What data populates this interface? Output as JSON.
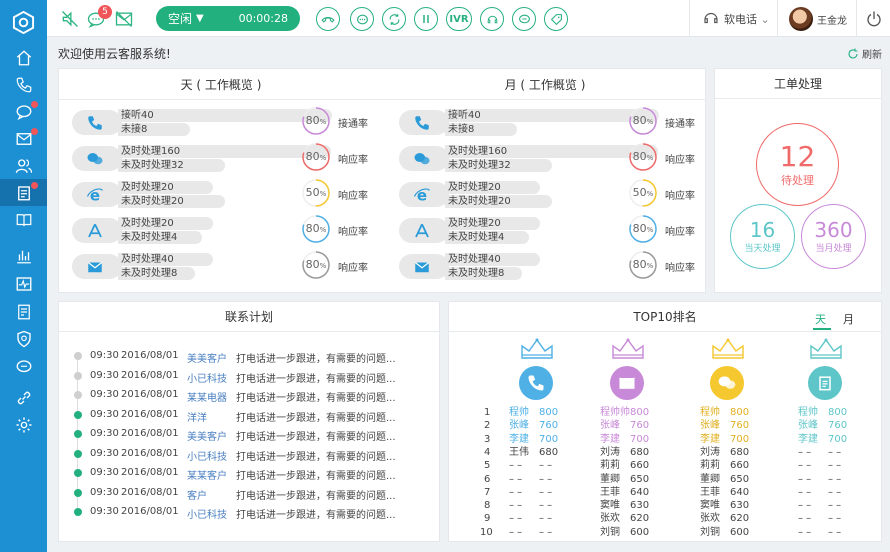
{
  "topbar": {
    "notif_count": "5",
    "status": "空闲",
    "timer": "00:00:28",
    "ivr_label": "IVR",
    "phone_mode": "软电话",
    "user_name": "王金龙"
  },
  "welcome": "欢迎使用云客服系统!",
  "refresh_label": "刷新",
  "overview_day": {
    "title": "天 ( 工作概览 )",
    "rows": [
      {
        "icon": "phone-icon",
        "line1": "接听40",
        "line2": "未接8",
        "rate": "80",
        "rate_label": "接通率",
        "color": "#c88ad8"
      },
      {
        "icon": "chat-icon",
        "line1": "及时处理160",
        "line2": "未及时处理32",
        "rate": "80",
        "rate_label": "响应率",
        "color": "#f06a6a"
      },
      {
        "icon": "ie-icon",
        "line1": "及时处理20",
        "line2": "未及时处理20",
        "rate": "50",
        "rate_label": "响应率",
        "color": "#f5c830"
      },
      {
        "icon": "appstore-icon",
        "line1": "及时处理20",
        "line2": "未及时处理4",
        "rate": "80",
        "rate_label": "响应率",
        "color": "#4fb0e6"
      },
      {
        "icon": "mail-icon",
        "line1": "及时处理40",
        "line2": "未及时处理8",
        "rate": "80",
        "rate_label": "响应率",
        "color": "#9a9a9a"
      }
    ]
  },
  "overview_month": {
    "title": "月 ( 工作概览 )",
    "rows": [
      {
        "icon": "phone-icon",
        "line1": "接听40",
        "line2": "未接8",
        "rate": "80",
        "rate_label": "接通率",
        "color": "#c88ad8"
      },
      {
        "icon": "chat-icon",
        "line1": "及时处理160",
        "line2": "未及时处理32",
        "rate": "80",
        "rate_label": "响应率",
        "color": "#f06a6a"
      },
      {
        "icon": "ie-icon",
        "line1": "及时处理20",
        "line2": "未及时处理20",
        "rate": "50",
        "rate_label": "响应率",
        "color": "#f5c830"
      },
      {
        "icon": "appstore-icon",
        "line1": "及时处理20",
        "line2": "未及时处理4",
        "rate": "80",
        "rate_label": "响应率",
        "color": "#4fb0e6"
      },
      {
        "icon": "mail-icon",
        "line1": "及时处理40",
        "line2": "未及时处理8",
        "rate": "80",
        "rate_label": "响应率",
        "color": "#9a9a9a"
      }
    ]
  },
  "workorder": {
    "title": "工单处理",
    "pending_value": "12",
    "pending_label": "待处理",
    "today_value": "16",
    "today_label": "当天处理",
    "month_value": "360",
    "month_label": "当月处理"
  },
  "contact_plan": {
    "title": "联系计划",
    "rows": [
      {
        "time": "09:30",
        "date": "2016/08/01",
        "customer": "美美客户",
        "note": "打电话进一步跟进，有需要的问题...",
        "done": false
      },
      {
        "time": "09:30",
        "date": "2016/08/01",
        "customer": "小已科技",
        "note": "打电话进一步跟进，有需要的问题...",
        "done": false
      },
      {
        "time": "09:30",
        "date": "2016/08/01",
        "customer": "某某电器",
        "note": "打电话进一步跟进，有需要的问题...",
        "done": false
      },
      {
        "time": "09:30",
        "date": "2016/08/01",
        "customer": "洋洋",
        "note": "打电话进一步跟进，有需要的问题...",
        "done": true
      },
      {
        "time": "09:30",
        "date": "2016/08/01",
        "customer": "美美客户",
        "note": "打电话进一步跟进，有需要的问题...",
        "done": true
      },
      {
        "time": "09:30",
        "date": "2016/08/01",
        "customer": "小已科技",
        "note": "打电话进一步跟进，有需要的问题...",
        "done": true
      },
      {
        "time": "09:30",
        "date": "2016/08/01",
        "customer": "某某客户",
        "note": "打电话进一步跟进，有需要的问题...",
        "done": true
      },
      {
        "time": "09:30",
        "date": "2016/08/01",
        "customer": "客户",
        "note": "打电话进一步跟进，有需要的问题...",
        "done": true
      },
      {
        "time": "09:30",
        "date": "2016/08/01",
        "customer": "小已科技",
        "note": "打电话进一步跟进，有需要的问题...",
        "done": true
      }
    ]
  },
  "top10": {
    "title": "TOP10排名",
    "tab_day": "天",
    "tab_month": "月",
    "categories": [
      {
        "icon": "phone-icon",
        "color": "#4fb0e6"
      },
      {
        "icon": "mail-icon",
        "color": "#c88ad8"
      },
      {
        "icon": "chat-icon",
        "color": "#f5c830"
      },
      {
        "icon": "clipboard-icon",
        "color": "#5ec6c8"
      }
    ],
    "ranks": [
      "1",
      "2",
      "3",
      "4",
      "5",
      "6",
      "7",
      "8",
      "9",
      "10"
    ],
    "columns": [
      [
        [
          "程帅",
          "800"
        ],
        [
          "张峰",
          "760"
        ],
        [
          "李建",
          "700"
        ],
        [
          "王伟",
          "680"
        ],
        [
          "– –",
          "– –"
        ],
        [
          "– –",
          "– –"
        ],
        [
          "– –",
          "– –"
        ],
        [
          "– –",
          "– –"
        ],
        [
          "– –",
          "– –"
        ],
        [
          "– –",
          "– –"
        ]
      ],
      [
        [
          "程帅帅",
          "800"
        ],
        [
          "张峰",
          "760"
        ],
        [
          "李建",
          "700"
        ],
        [
          "刘涛",
          "680"
        ],
        [
          "莉莉",
          "660"
        ],
        [
          "董卿",
          "650"
        ],
        [
          "王菲",
          "640"
        ],
        [
          "窦唯",
          "630"
        ],
        [
          "张欢",
          "620"
        ],
        [
          "刘铜",
          "600"
        ]
      ],
      [
        [
          "程帅",
          "800"
        ],
        [
          "张峰",
          "760"
        ],
        [
          "李建",
          "700"
        ],
        [
          "刘涛",
          "680"
        ],
        [
          "莉莉",
          "660"
        ],
        [
          "董卿",
          "650"
        ],
        [
          "王菲",
          "640"
        ],
        [
          "窦唯",
          "630"
        ],
        [
          "张欢",
          "620"
        ],
        [
          "刘铜",
          "600"
        ]
      ],
      [
        [
          "程帅",
          "800"
        ],
        [
          "张峰",
          "760"
        ],
        [
          "李建",
          "700"
        ],
        [
          "– –",
          "– –"
        ],
        [
          "– –",
          "– –"
        ],
        [
          "– –",
          "– –"
        ],
        [
          "– –",
          "– –"
        ],
        [
          "– –",
          "– –"
        ],
        [
          "– –",
          "– –"
        ],
        [
          "– –",
          "– –"
        ]
      ]
    ],
    "top3_colors": [
      "#4fb0e6",
      "#c88ad8",
      "#e0b020",
      "#5ec6c8"
    ]
  }
}
